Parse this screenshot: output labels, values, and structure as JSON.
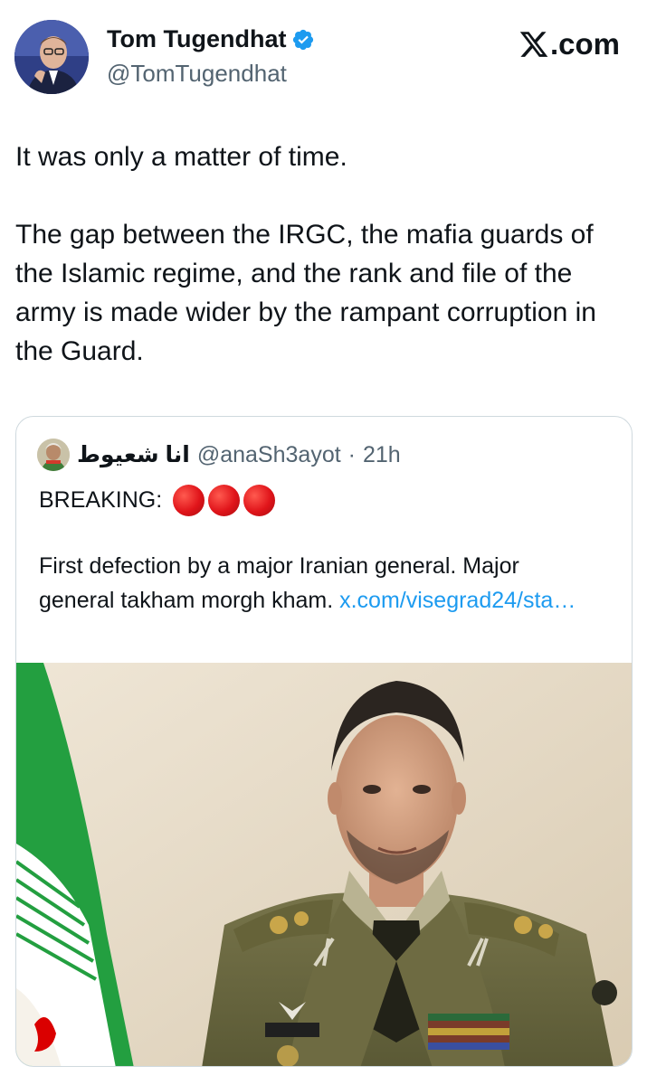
{
  "brand": {
    "site": ".com",
    "accent": "#1d9bf0",
    "verified_color": "#1d9bf0"
  },
  "tweet": {
    "author": {
      "display_name": "Tom Tugendhat",
      "handle": "@TomTugendhat",
      "verified": true
    },
    "paragraphs": [
      "It was only a matter of time.",
      "The gap between the IRGC, the mafia guards of the Islamic regime, and the rank and file of the army is made wider by the rampant corruption in the Guard."
    ]
  },
  "quote": {
    "author_name": "انا شعيوط",
    "handle": "@anaSh3ayot",
    "separator": "·",
    "time": "21h",
    "breaking_label": "BREAKING:",
    "emoji_circles": [
      "red-circle",
      "red-circle",
      "red-circle"
    ],
    "text": "First defection by a major Iranian general. Major general takham morgh kham. ",
    "link_text": "x.com/visegrad24/sta…",
    "image": {
      "description_icon": "general-portrait-photo",
      "colors": {
        "background": "#e8dcc8",
        "uniform": "#6b6a42",
        "flag_green": "#239f40",
        "flag_red": "#da0000"
      }
    }
  }
}
